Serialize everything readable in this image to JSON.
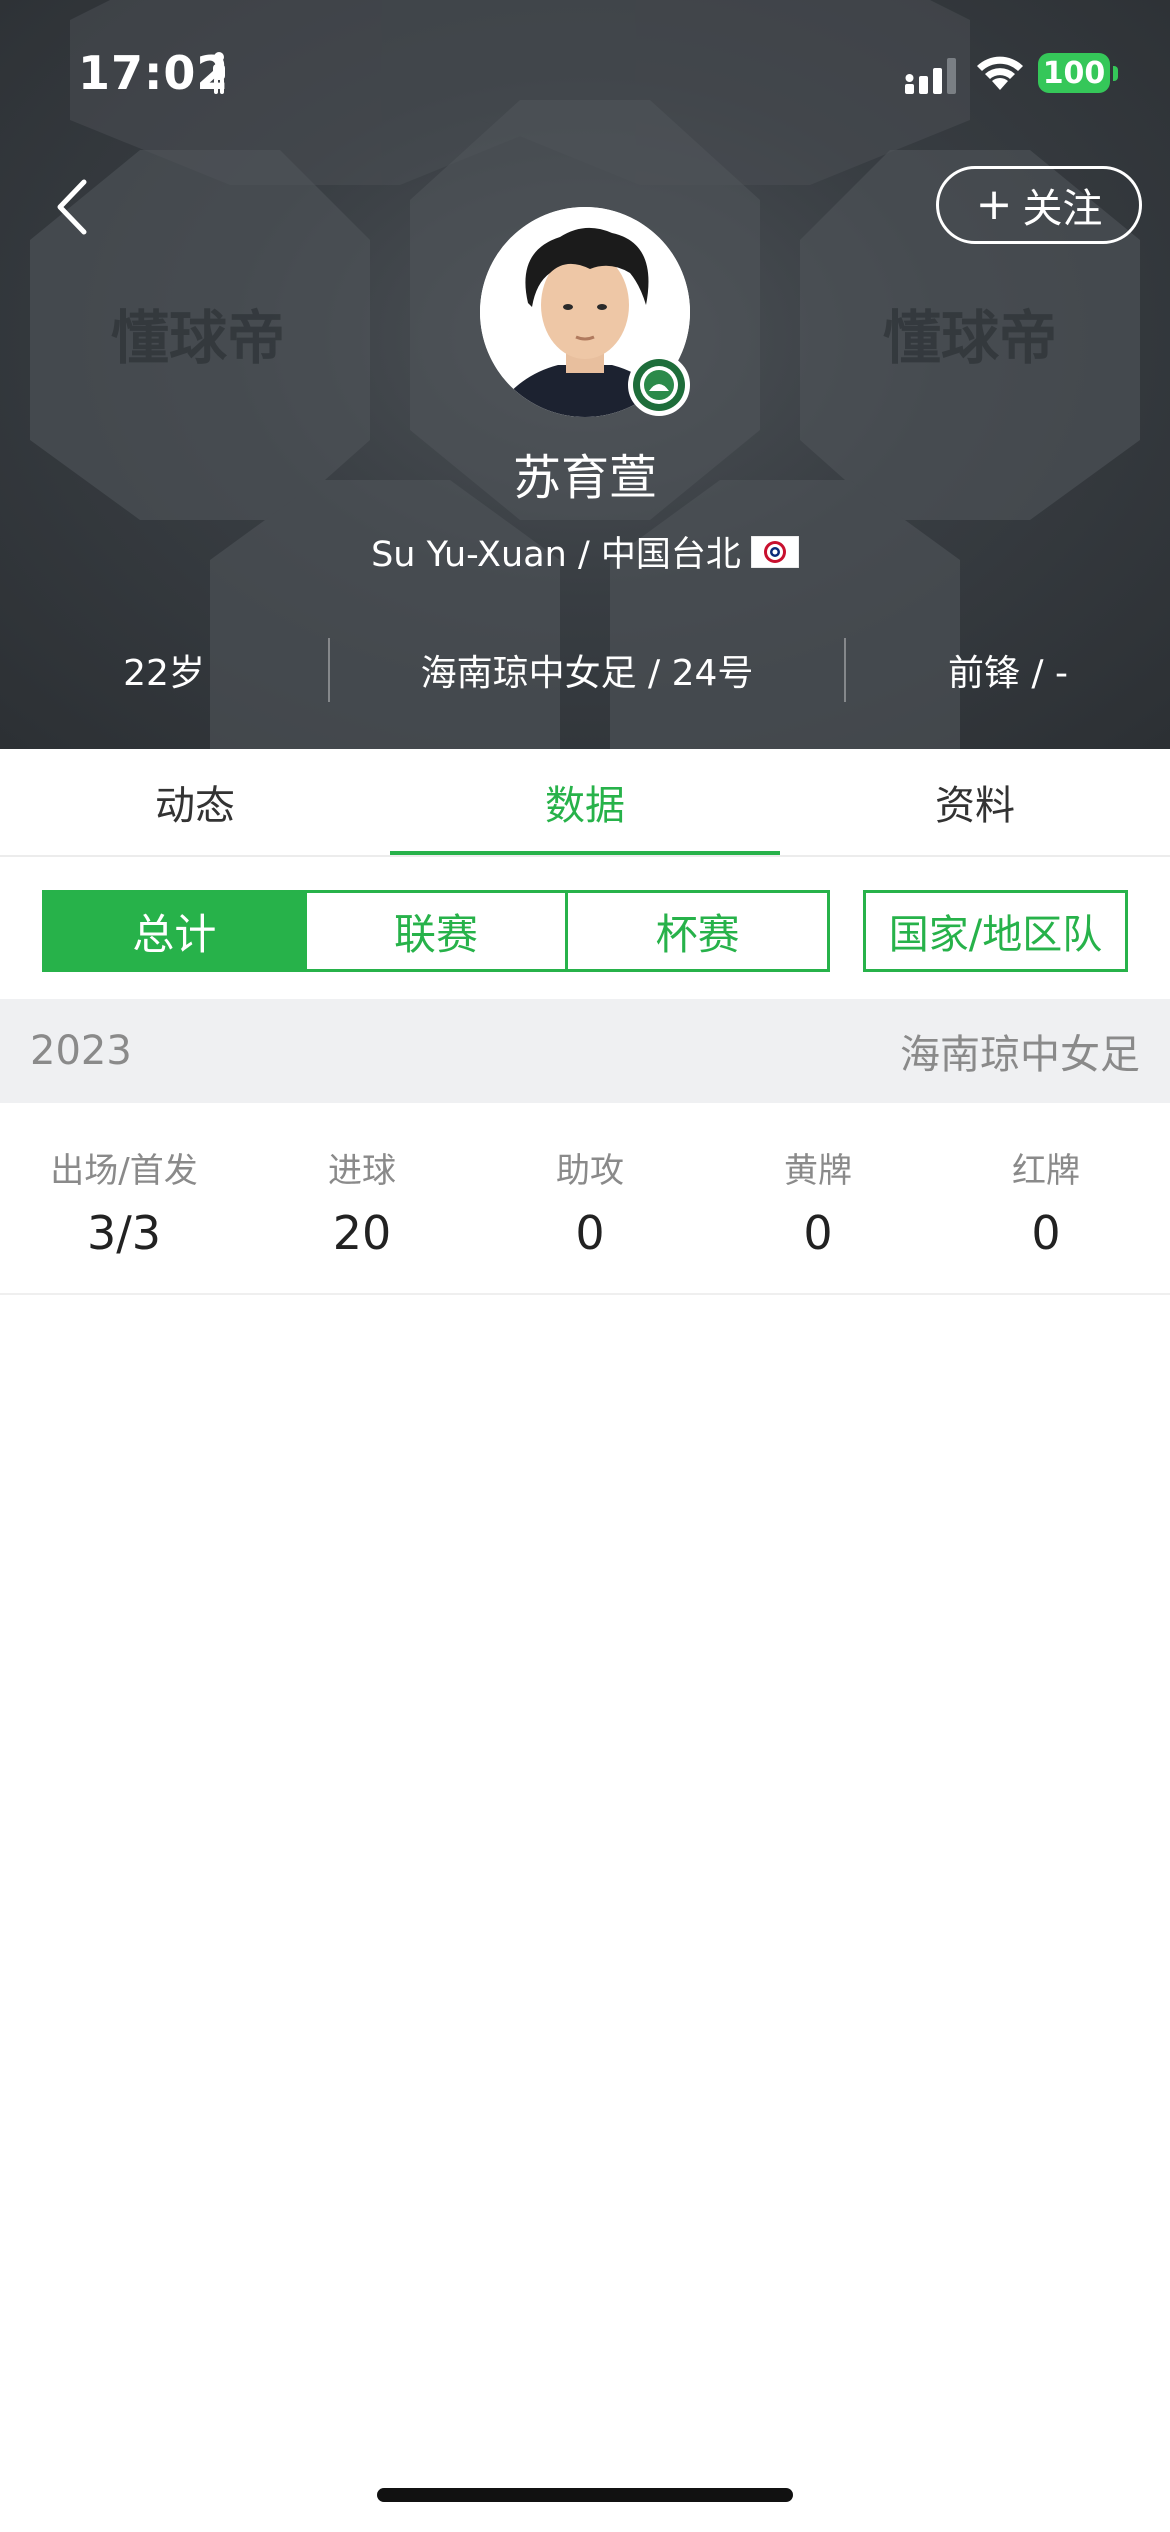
{
  "status_bar": {
    "time": "17:02",
    "battery": "100"
  },
  "header": {
    "follow_label": "关注",
    "player_name": "苏育萱",
    "player_name_en": "Su Yu-Xuan / 中国台北",
    "watermark": "懂球帝"
  },
  "info": {
    "age": "22岁",
    "club_number": "海南琼中女足 / 24号",
    "position": "前锋 / -"
  },
  "tabs": [
    {
      "label": "动态"
    },
    {
      "label": "数据"
    },
    {
      "label": "资料"
    }
  ],
  "active_tab": "数据",
  "segments": [
    {
      "label": "总计"
    },
    {
      "label": "联赛"
    },
    {
      "label": "杯赛"
    }
  ],
  "country_segment": "国家/地区队",
  "season": {
    "year": "2023",
    "team": "海南琼中女足"
  },
  "stats": [
    {
      "label": "出场/首发",
      "value": "3/3"
    },
    {
      "label": "进球",
      "value": "20"
    },
    {
      "label": "助攻",
      "value": "0"
    },
    {
      "label": "黄牌",
      "value": "0"
    },
    {
      "label": "红牌",
      "value": "0"
    }
  ],
  "colors": {
    "accent": "#27b24a",
    "header_bg": "#383d42",
    "season_bg": "#eff0f2"
  }
}
